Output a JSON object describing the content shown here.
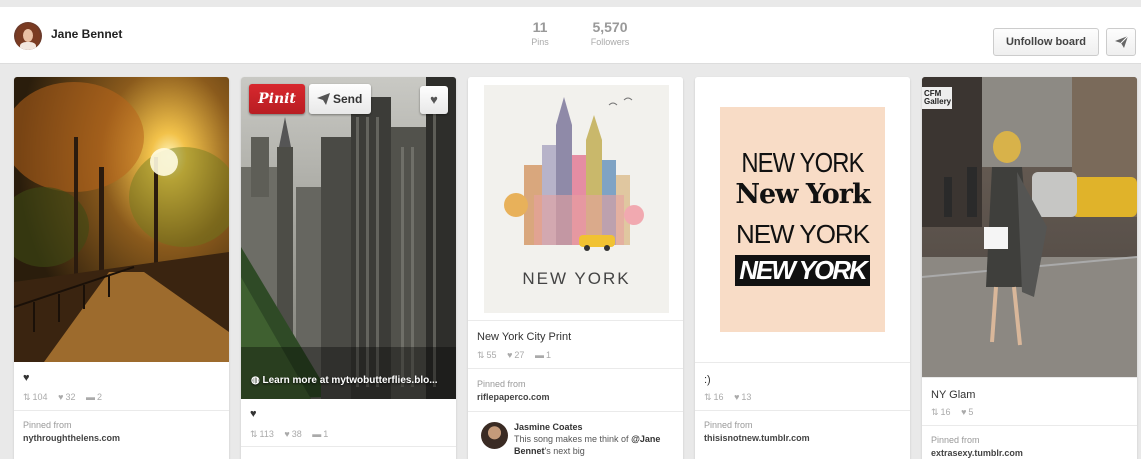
{
  "header": {
    "user_name": "Jane Bennet",
    "pins": {
      "value": "11",
      "label": "Pins"
    },
    "followers": {
      "value": "5,570",
      "label": "Followers"
    },
    "unfollow_label": "Unfollow board",
    "send_icon": "paper-plane-icon"
  },
  "pins": [
    {
      "description": "♥",
      "repins": "104",
      "likes": "32",
      "comments": "2",
      "pinned_from_label": "Pinned from",
      "source": "nythroughthelens.com"
    },
    {
      "overlay": {
        "pinit_label": "Pinit",
        "send_label": "Send",
        "learn_more": "Learn more at mytwobutterflies.blo..."
      },
      "description": "♥",
      "repins": "113",
      "likes": "38",
      "comments": "1"
    },
    {
      "image_caption": "NEW YORK",
      "description": "New York City Print",
      "repins": "55",
      "likes": "27",
      "comments": "1",
      "pinned_from_label": "Pinned from",
      "source": "riflepaperco.com",
      "comment": {
        "author": "Jasmine Coates",
        "text_before": "This song makes me think of",
        "mention": "@Jane Bennet",
        "text_after": "'s next big"
      }
    },
    {
      "poster_lines": [
        "NEW YORK",
        "New York",
        "NEW YORK",
        "NEW YORK"
      ],
      "description": ":)",
      "repins": "16",
      "likes": "13",
      "pinned_from_label": "Pinned from",
      "source": "thisisnotnew.tumblr.com"
    },
    {
      "image_sign": "CFM Gallery",
      "description": "NY Glam",
      "repins": "16",
      "likes": "5",
      "pinned_from_label": "Pinned from",
      "source": "extrasexy.tumblr.com"
    }
  ],
  "colors": {
    "pinit_red": "#cb2027",
    "background": "#e9e9e9"
  }
}
